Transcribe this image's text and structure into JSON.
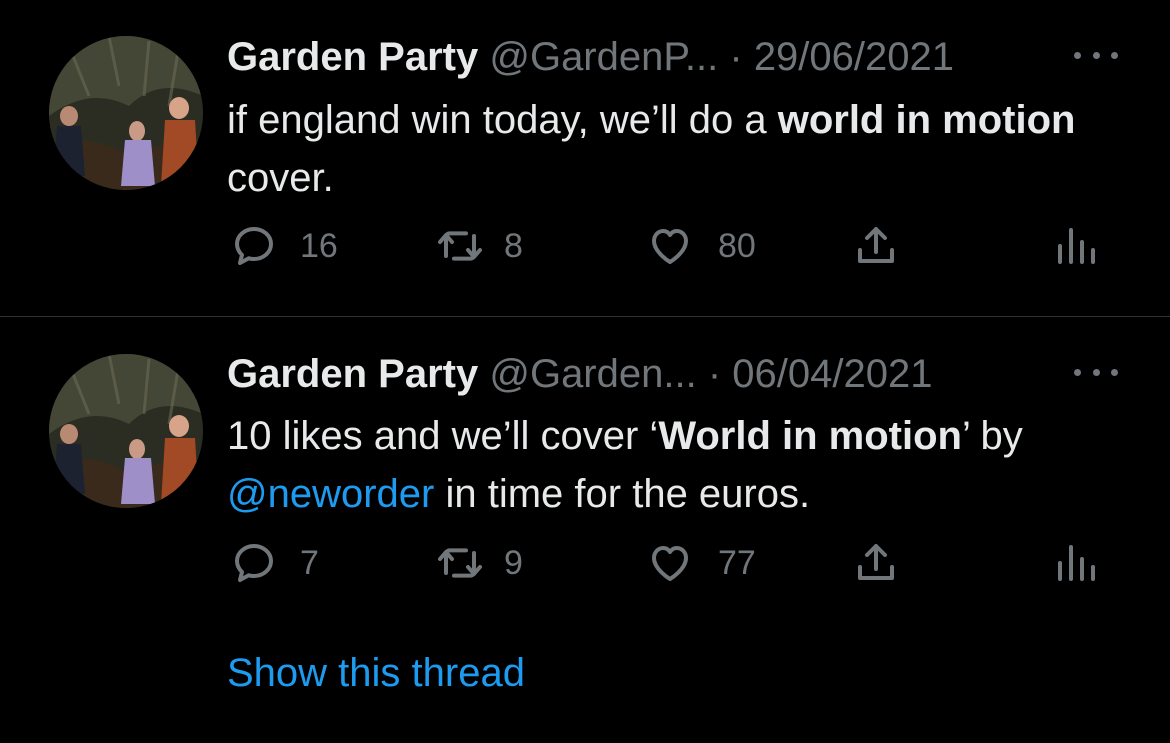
{
  "tweets": [
    {
      "author_name": "Garden Party",
      "handle": "@GardenP...",
      "separator": "·",
      "date": "29/06/2021",
      "text": {
        "part1": "if england win today, we’ll do a ",
        "bold1": "world in motion",
        "part2": " cover."
      },
      "replies": "16",
      "retweets": "8",
      "likes": "80"
    },
    {
      "author_name": "Garden Party",
      "handle": "@Garden...",
      "separator": "·",
      "date": "06/04/2021",
      "text": {
        "part1": "10 likes and we’ll cover ‘",
        "bold1": "World in motion",
        "part2": "’ by ",
        "mention": "@neworder",
        "part3": " in time for the euros."
      },
      "replies": "7",
      "retweets": "9",
      "likes": "77"
    }
  ],
  "show_thread_label": "Show this thread",
  "icons": {
    "reply": "reply-icon",
    "retweet": "retweet-icon",
    "like": "heart-icon",
    "share": "share-icon",
    "stats": "analytics-icon",
    "more": "more-icon"
  },
  "colors": {
    "background": "#000000",
    "text": "#e7e9ea",
    "muted": "#71767b",
    "link": "#1d9bf0",
    "divider": "#2f3336"
  }
}
